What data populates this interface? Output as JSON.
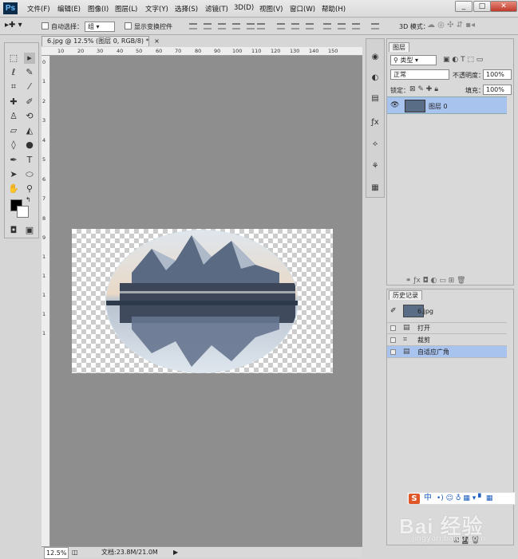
{
  "app": {
    "logo": "Ps"
  },
  "menu": [
    "文件(F)",
    "编辑(E)",
    "图像(I)",
    "图层(L)",
    "文字(Y)",
    "选择(S)",
    "滤镜(T)",
    "3D(D)",
    "视图(V)",
    "窗口(W)",
    "帮助(H)"
  ],
  "options": {
    "auto_select_label": "自动选择：",
    "auto_select_value": "组",
    "show_transform_label": "显示变换控件",
    "mode_3d_label": "3D 模式："
  },
  "document": {
    "tab_title": "6.jpg @ 12.5% (图层 0, RGB/8) *",
    "ruler_top": [
      "10",
      "20",
      "30",
      "40",
      "50",
      "60",
      "70",
      "80",
      "90",
      "100",
      "110",
      "120",
      "130",
      "140",
      "150"
    ],
    "ruler_left": [
      "0",
      "1",
      "2",
      "3",
      "4",
      "5",
      "6",
      "7",
      "8",
      "9",
      "1",
      "1",
      "1",
      "1",
      "1"
    ],
    "zoom": "12.5%",
    "doc_size": "文档:23.8M/21.0M"
  },
  "layers": {
    "tab": "图层",
    "filter_kind": "类型",
    "blend_mode": "正常",
    "opacity_label": "不透明度：",
    "opacity_value": "100%",
    "lock_label": "锁定：",
    "fill_label": "填充：",
    "fill_value": "100%",
    "items": [
      {
        "name": "图层 0"
      }
    ]
  },
  "history": {
    "tab": "历史记录",
    "snapshot": "6.jpg",
    "items": [
      {
        "label": "打开",
        "icon": "document-icon"
      },
      {
        "label": "裁剪",
        "icon": "crop-icon"
      },
      {
        "label": "自适应广角",
        "icon": "document-icon",
        "active": true
      }
    ]
  },
  "watermark": {
    "ime": "中",
    "brand": "Bai 经验",
    "url": "jingyan.baidu.com"
  },
  "colors": {
    "selection": "#a9c3ef",
    "canvas_bg": "#8e8e8e",
    "panel_bg": "#d9d9d9"
  }
}
